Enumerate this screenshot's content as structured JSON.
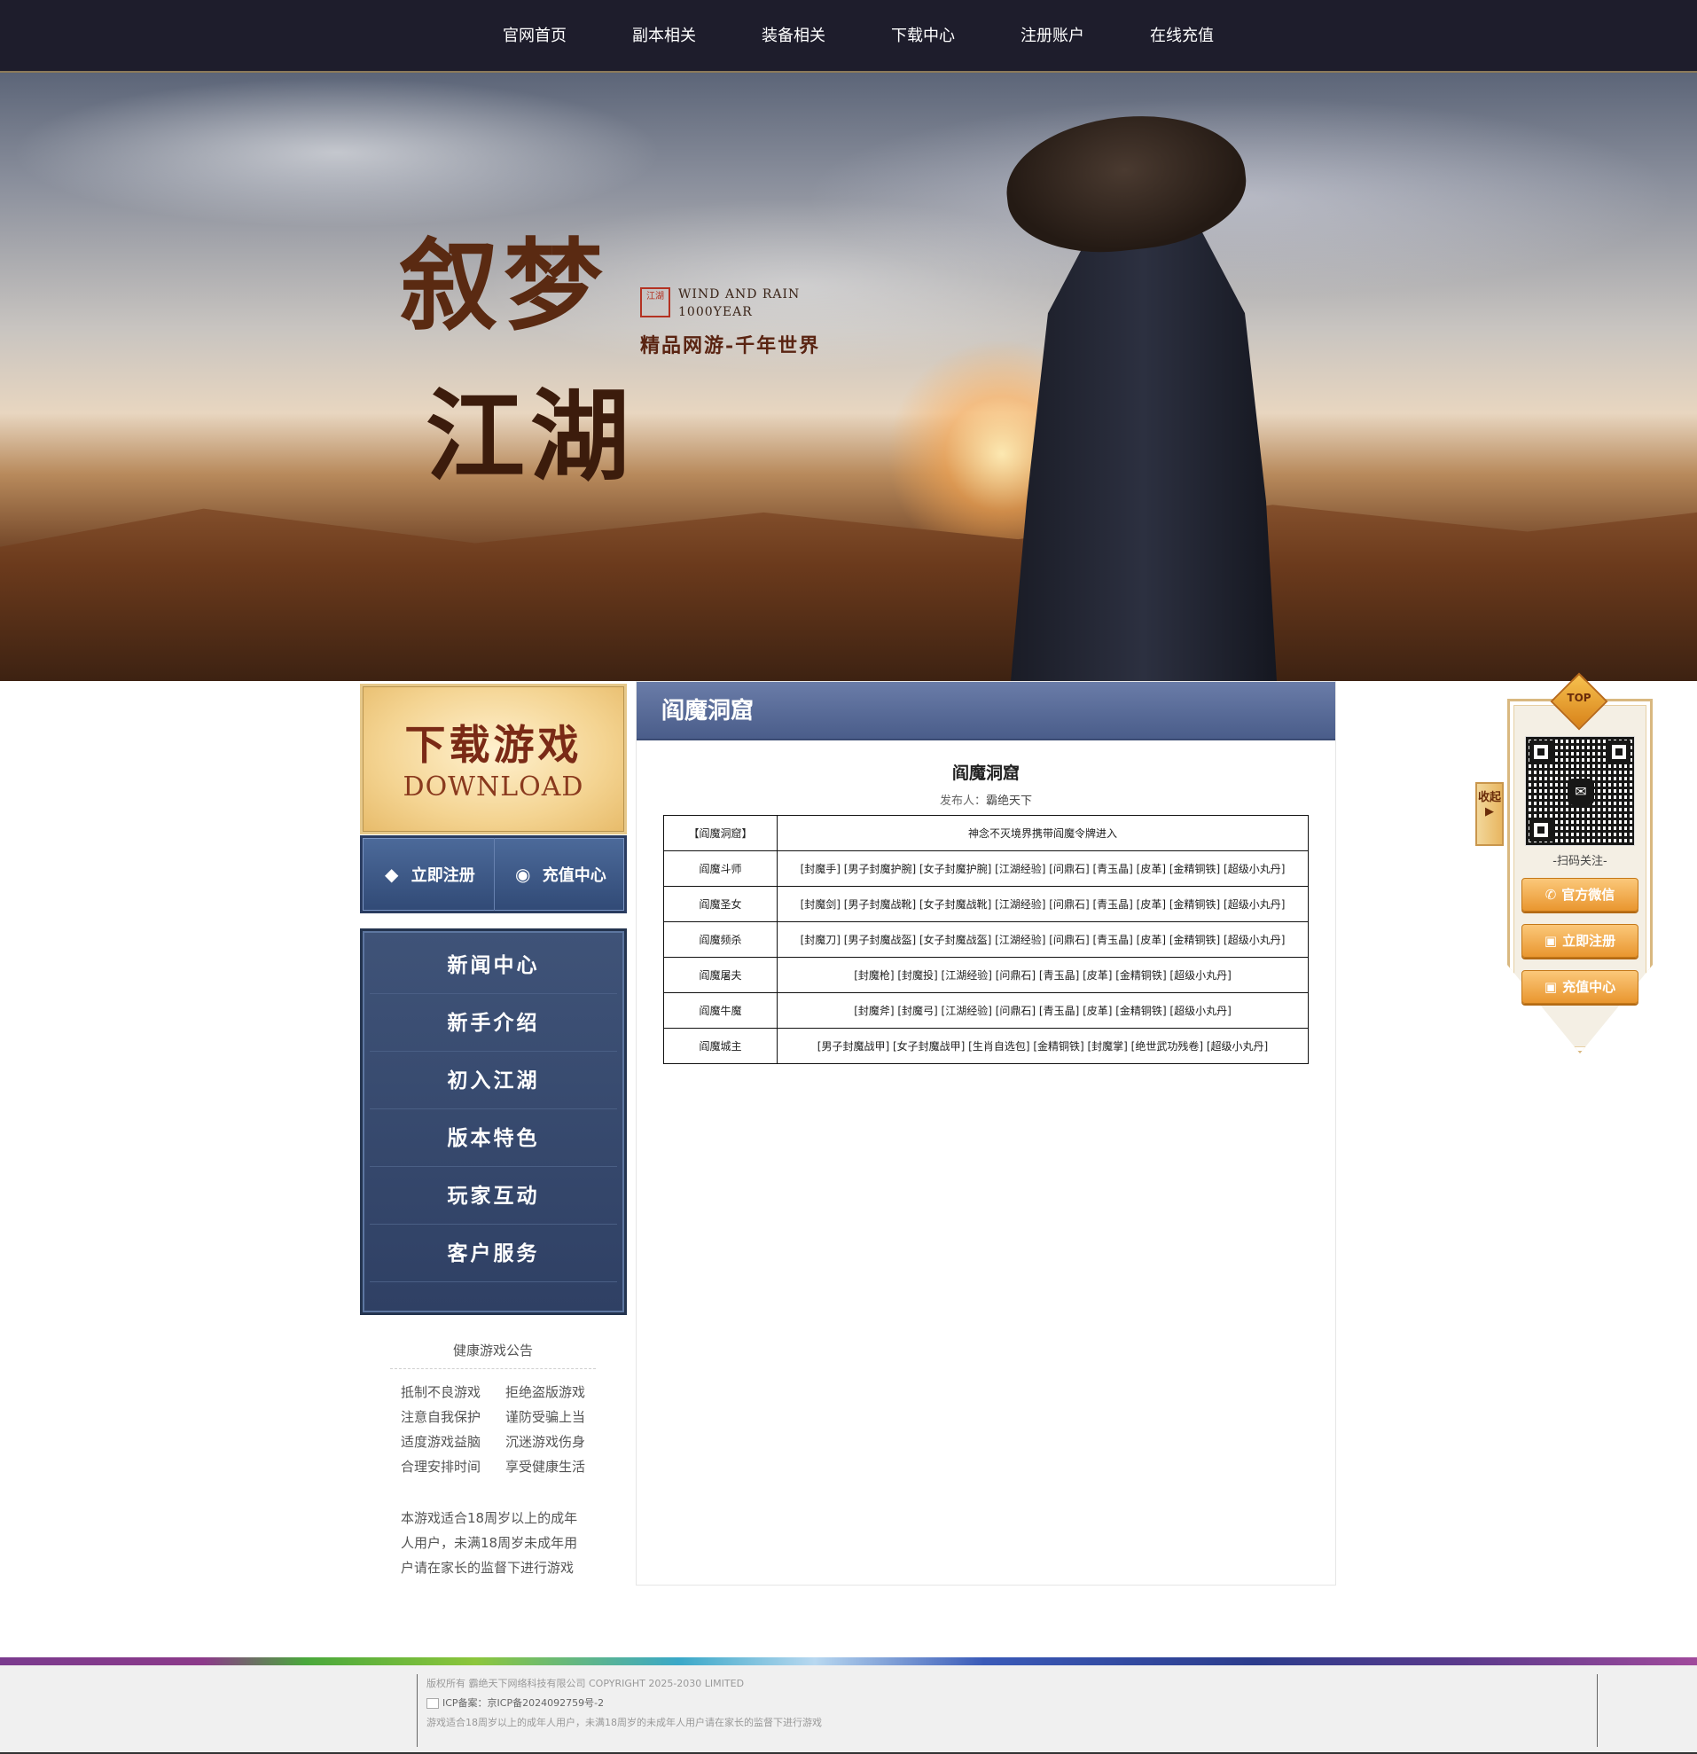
{
  "nav": {
    "items": [
      "官网首页",
      "副本相关",
      "装备相关",
      "下载中心",
      "注册账户",
      "在线充值"
    ]
  },
  "banner": {
    "calligraphy_line1": "叙梦",
    "calligraphy_line2": "江湖",
    "seal_text": "江湖",
    "en_line1": "WIND AND RAIN",
    "en_line2": "1000YEAR",
    "slogan": "精品网游-千年世界"
  },
  "left": {
    "download": {
      "cn": "下载游戏",
      "en": "DOWNLOAD"
    },
    "actions": [
      {
        "label": "立即注册",
        "icon": "diamond-icon"
      },
      {
        "label": "充值中心",
        "icon": "coin-icon"
      }
    ],
    "menu": [
      "新闻中心",
      "新手介绍",
      "初入江湖",
      "版本特色",
      "玩家互动",
      "客户服务"
    ],
    "notice": {
      "title": "健康游戏公告",
      "rows": [
        [
          "抵制不良游戏",
          "拒绝盗版游戏"
        ],
        [
          "注意自我保护",
          "谨防受骗上当"
        ],
        [
          "适度游戏益脑",
          "沉迷游戏伤身"
        ],
        [
          "合理安排时间",
          "享受健康生活"
        ]
      ],
      "para": "本游戏适合18周岁以上的成年人用户，未满18周岁未成年用户请在家长的监督下进行游戏"
    }
  },
  "content": {
    "bar_title": "阎魔洞窟",
    "title": "阎魔洞窟",
    "author_label": "发布人：",
    "author_name": "霸绝天下",
    "table": [
      {
        "name": "【阎魔洞窟】",
        "drops": "神念不灭境界携带阎魔令牌进入",
        "highlight": true
      },
      {
        "name": "阎魔斗师",
        "drops": "[封魔手] [男子封魔护腕] [女子封魔护腕] [江湖经验] [问鼎石] [青玉晶] [皮革] [金精铜铁] [超级小丸丹]"
      },
      {
        "name": "阎魔圣女",
        "drops": "[封魔剑] [男子封魔战靴] [女子封魔战靴] [江湖经验] [问鼎石] [青玉晶] [皮革] [金精铜铁] [超级小丸丹]"
      },
      {
        "name": "阎魔频杀",
        "drops": "[封魔刀] [男子封魔战盔] [女子封魔战盔] [江湖经验] [问鼎石] [青玉晶] [皮革] [金精铜铁] [超级小丸丹]"
      },
      {
        "name": "阎魔屠夫",
        "drops": "[封魔枪] [封魔投] [江湖经验] [问鼎石] [青玉晶] [皮革] [金精铜铁] [超级小丸丹]"
      },
      {
        "name": "阎魔牛魔",
        "drops": "[封魔斧] [封魔弓] [江湖经验] [问鼎石] [青玉晶] [皮革] [金精铜铁] [超级小丸丹]"
      },
      {
        "name": "阎魔城主",
        "drops": "[男子封魔战甲] [女子封魔战甲] [生肖自选包] [金精铜铁] [封魔掌] [绝世武功残卷] [超级小丸丹]"
      }
    ]
  },
  "float": {
    "top_label": "TOP",
    "collapse_label": "收起",
    "scan_label": "-扫码关注-",
    "buttons": [
      {
        "label": "官方微信",
        "icon": "wechat-icon"
      },
      {
        "label": "立即注册",
        "icon": "gift-icon"
      },
      {
        "label": "充值中心",
        "icon": "gift-icon"
      }
    ]
  },
  "footer": {
    "copyright": "版权所有 霸绝天下网络科技有限公司 COPYRIGHT 2025-2030 LIMITED",
    "icp": "ICP备案：京ICP备2024092759号-2",
    "notice": "游戏适合18周岁以上的成年人用户，未满18周岁的未成年人用户请在家长的监督下进行游戏"
  },
  "colors": {
    "nav_bg": "#1e1d2c",
    "content_bar": "#4a5d8a",
    "highlight_red": "#d0201a",
    "highlight_pink": "#d21cc4",
    "float_button": "#e9962f"
  }
}
